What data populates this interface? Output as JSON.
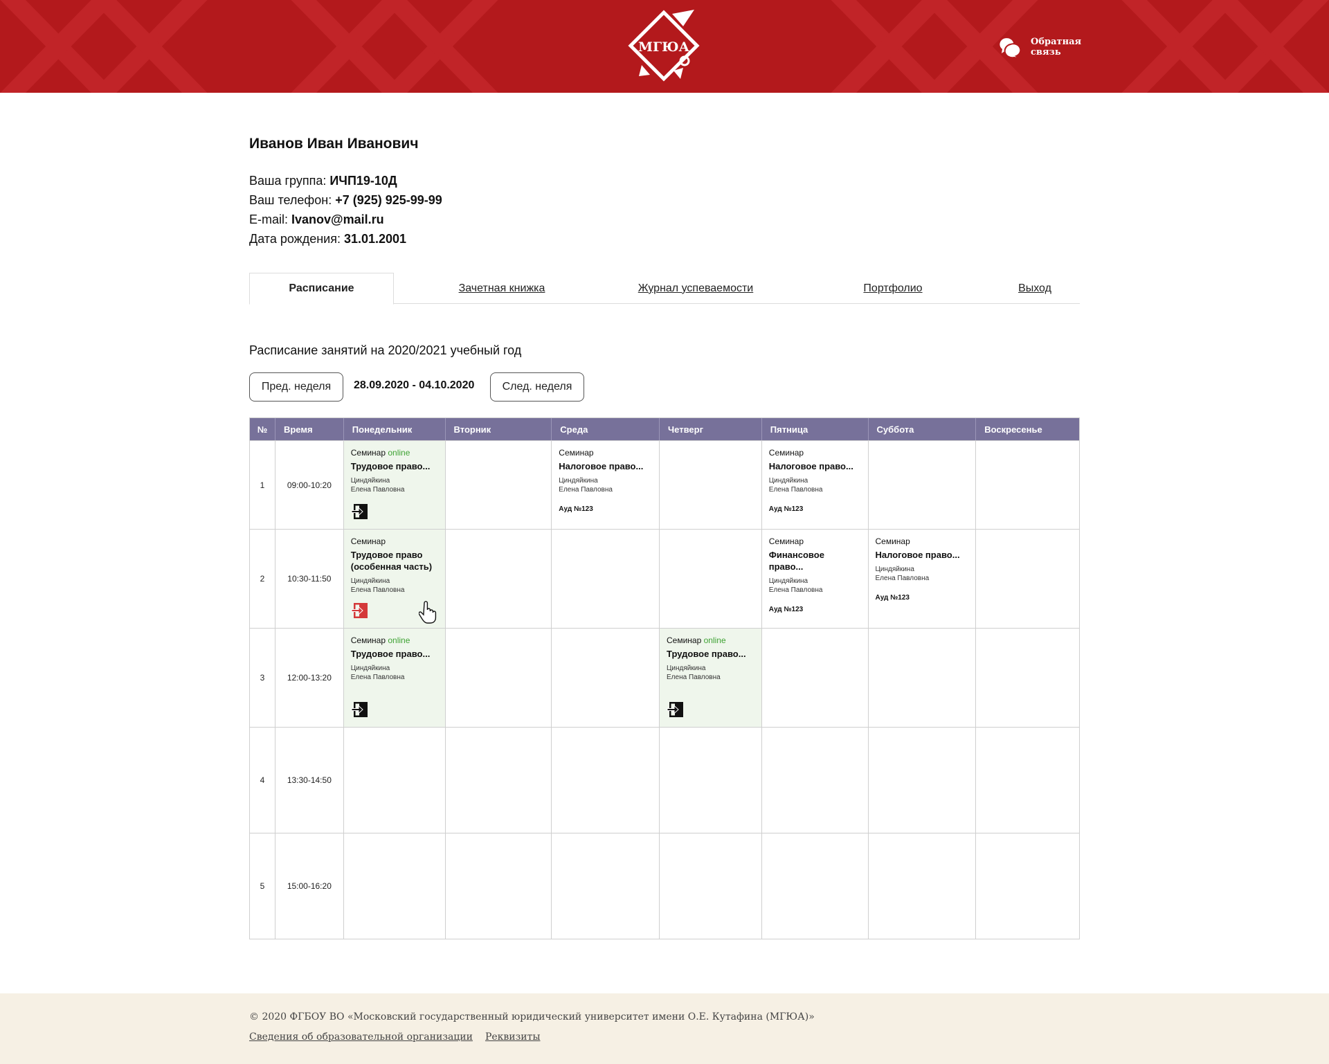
{
  "header": {
    "logo_text": "МГЮА",
    "feedback_line1": "Обратная",
    "feedback_line2": "связь"
  },
  "profile": {
    "name": "Иванов Иван Иванович",
    "group_label": "Ваша группа: ",
    "group": "ИЧП19-10Д",
    "phone_label": "Ваш телефон: ",
    "phone": "+7 (925) 925-99-99",
    "email_label": "E-mail: ",
    "email": "Ivanov@mail.ru",
    "birth_label": "Дата рождения: ",
    "birth": "31.01.2001"
  },
  "tabs": [
    {
      "label": "Расписание",
      "active": true
    },
    {
      "label": "Зачетная книжка",
      "active": false
    },
    {
      "label": "Журнал успеваемости",
      "active": false
    },
    {
      "label": "Портфолио",
      "active": false
    },
    {
      "label": "Выход",
      "active": false
    }
  ],
  "schedule": {
    "title": "Расписание занятий на 2020/2021 учебный год",
    "prev_week": "Пред. неделя",
    "next_week": "След. неделя",
    "week_range": "28.09.2020 - 04.10.2020",
    "columns": [
      "№",
      "Время",
      "Понедельник",
      "Вторник",
      "Среда",
      "Четверг",
      "Пятница",
      "Суббота",
      "Воскресенье"
    ],
    "rows": [
      {
        "num": "1",
        "time": "09:00-10:20",
        "cells": [
          {
            "type": "Семинар",
            "online": "online",
            "title": "Трудовое право...",
            "teacher1": "Циндяйкина",
            "teacher2": "Елена Павловна",
            "icon": "black"
          },
          null,
          {
            "type": "Семинар",
            "title": "Налоговое право...",
            "teacher1": "Циндяйкина",
            "teacher2": "Елена Павловна",
            "room": "Ауд №123"
          },
          null,
          {
            "type": "Семинар",
            "title": "Налоговое право...",
            "teacher1": "Циндяйкина",
            "teacher2": "Елена Павловна",
            "room": "Ауд №123"
          },
          null,
          null
        ]
      },
      {
        "num": "2",
        "time": "10:30-11:50",
        "cells": [
          {
            "type": "Семинар",
            "title": "Трудовое право (особенная часть)",
            "teacher1": "Циндяйкина",
            "teacher2": "Елена Павловна",
            "icon": "red",
            "cursor": true
          },
          null,
          null,
          null,
          {
            "type": "Семинар",
            "title": "Финансовое право...",
            "teacher1": "Циндяйкина",
            "teacher2": "Елена Павловна",
            "room": "Ауд №123"
          },
          {
            "type": "Семинар",
            "title": "Налоговое право...",
            "teacher1": "Циндяйкина",
            "teacher2": "Елена Павловна",
            "room": "Ауд №123"
          },
          null
        ]
      },
      {
        "num": "3",
        "time": "12:00-13:20",
        "cells": [
          {
            "type": "Семинар",
            "online": "online",
            "title": "Трудовое право...",
            "teacher1": "Циндяйкина",
            "teacher2": "Елена Павловна",
            "icon": "black"
          },
          null,
          null,
          {
            "type": "Семинар",
            "online": "online",
            "title": "Трудовое право...",
            "teacher1": "Циндяйкина",
            "teacher2": "Елена Павловна",
            "icon": "black"
          },
          null,
          null,
          null
        ]
      },
      {
        "num": "4",
        "time": "13:30-14:50",
        "cells": [
          null,
          null,
          null,
          null,
          null,
          null,
          null
        ]
      },
      {
        "num": "5",
        "time": "15:00-16:20",
        "cells": [
          null,
          null,
          null,
          null,
          null,
          null,
          null
        ]
      }
    ]
  },
  "footer": {
    "copyright": "© 2020 ФГБОУ ВО «Московский государственный юридический университет имени О.Е. Кутафина (МГЮА)»",
    "link1": "Сведения об образовательной организации",
    "link2": "Реквизиты"
  },
  "colors": {
    "header_red": "#b3191c",
    "table_header": "#77719a",
    "online_green": "#3ea233",
    "online_bg": "#eff6ec",
    "footer_bg": "#f6f0e4",
    "enter_red": "#d4393a"
  }
}
